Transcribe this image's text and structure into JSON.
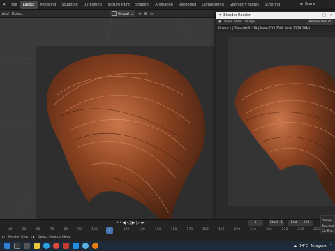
{
  "workspaces": [
    "Layout",
    "Modeling",
    "Sculpting",
    "UV Editing",
    "Texture Paint",
    "Shading",
    "Animation",
    "Rendering",
    "Compositing",
    "Geometry Nodes",
    "Scripting"
  ],
  "scene_label": "Scene",
  "header": {
    "add": "Add",
    "object": "Object",
    "orientation": "Global"
  },
  "render_window": {
    "title": "Blender Render",
    "menu": [
      "View",
      "View",
      "Image"
    ],
    "slot": "Render Result",
    "info": "Frame:1 | Time:00:01.29 | Mem:103.75M, Peak 1229.29M)"
  },
  "timeline": {
    "current_frame": "1",
    "start_label": "Start",
    "start": "1",
    "end_label": "End",
    "end": "250",
    "ticks": [
      "40",
      "50",
      "60",
      "70",
      "80",
      "90",
      "100",
      "110",
      "120",
      "130",
      "150",
      "160",
      "170",
      "180",
      "190",
      "200",
      "210",
      "220",
      "230",
      "240",
      "250"
    ],
    "playhead": "1"
  },
  "side_panel": [
    "Remap",
    "Successf",
    "Confirm"
  ],
  "statusbar": [
    "Render View",
    "Object Context Menu"
  ],
  "tray": {
    "weather": "14°C",
    "location": "Nuageux"
  },
  "colors": {
    "accent": "#4772b3",
    "hair_dark": "#4a2413",
    "hair_mid": "#8b4220",
    "hair_light": "#c9764a",
    "taskbar": "#1e2a38"
  }
}
